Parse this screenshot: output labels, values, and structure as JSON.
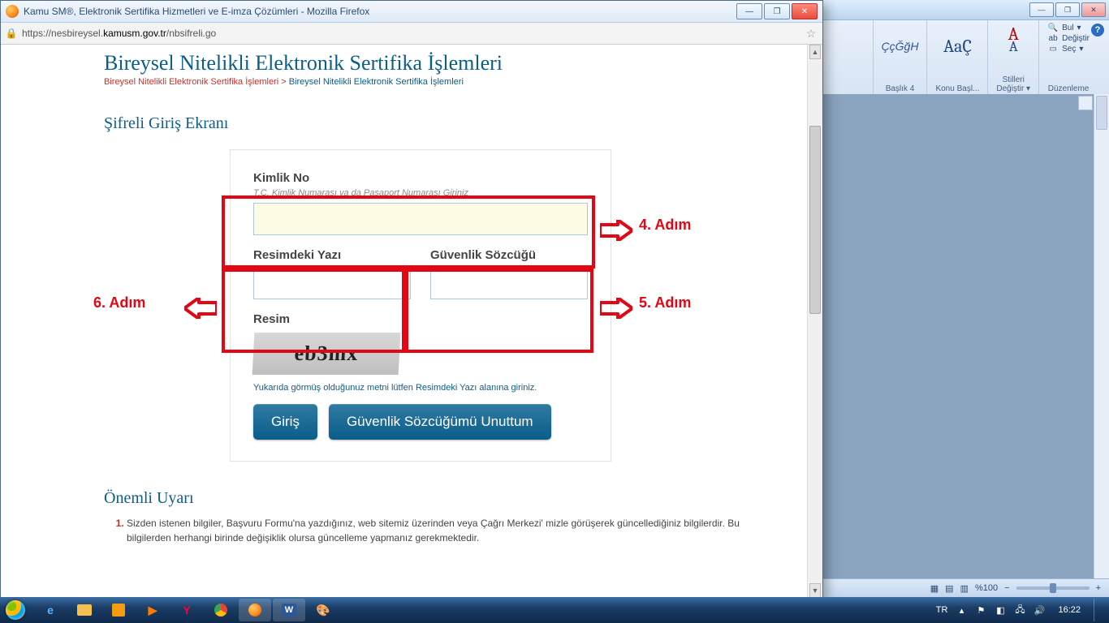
{
  "browser": {
    "title": "Kamu SM®, Elektronik Sertifika Hizmetleri ve E-imza Çözümleri - Mozilla Firefox",
    "url_pre": "https://nesbireysel.",
    "url_host": "kamusm.gov.tr",
    "url_post": "/nbsifreli.go"
  },
  "page": {
    "title": "Bireysel Nitelikli Elektronik Sertifika İşlemleri",
    "breadcrumb_link": "Bireysel Nitelikli Elektronik Sertifika İşlemleri",
    "breadcrumb_sep": " > ",
    "breadcrumb_current": "Bireysel Nitelikli Elektronik Sertifika İşlemleri",
    "section": "Şifreli Giriş Ekranı",
    "form": {
      "kimlik_label": "Kimlik No",
      "kimlik_hint": "T.C. Kimlik Numarası ya da Pasaport Numarası Giriniz",
      "resimdeki_label": "Resimdeki Yazı",
      "guvenlik_label": "Güvenlik Sözcüğü",
      "resim_label": "Resim",
      "captcha_text": "eb3mx",
      "captcha_note": "Yukarıda görmüş olduğunuz metni lütfen Resimdeki Yazı alanına giriniz.",
      "btn_giris": "Giriş",
      "btn_unuttum": "Güvenlik Sözcüğümü Unuttum"
    },
    "warn_heading": "Önemli Uyarı",
    "note1": "Sizden istenen bilgiler, Başvuru Formu'na yazdığınız, web sitemiz üzerinden veya Çağrı Merkezi' mizle görüşerek güncellediğiniz bilgilerdir. Bu bilgilerden herhangi birinde değişiklik olursa güncelleme yapmanız gerekmektedir."
  },
  "annotations": {
    "step4": "4. Adım",
    "step5": "5. Adım",
    "step6": "6. Adım"
  },
  "word": {
    "style1": "ÇçĞğH",
    "style1_label": "Başlık 4",
    "style2": "AaÇ",
    "style2_label": "Konu Başl...",
    "changeStyles1": "Stilleri",
    "changeStyles2": "Değiştir",
    "find": "Bul",
    "replace": "Değiştir",
    "select": "Seç",
    "group_edit": "Düzenleme",
    "zoom": "%100"
  },
  "tray": {
    "lang": "TR",
    "time": "16:22"
  }
}
